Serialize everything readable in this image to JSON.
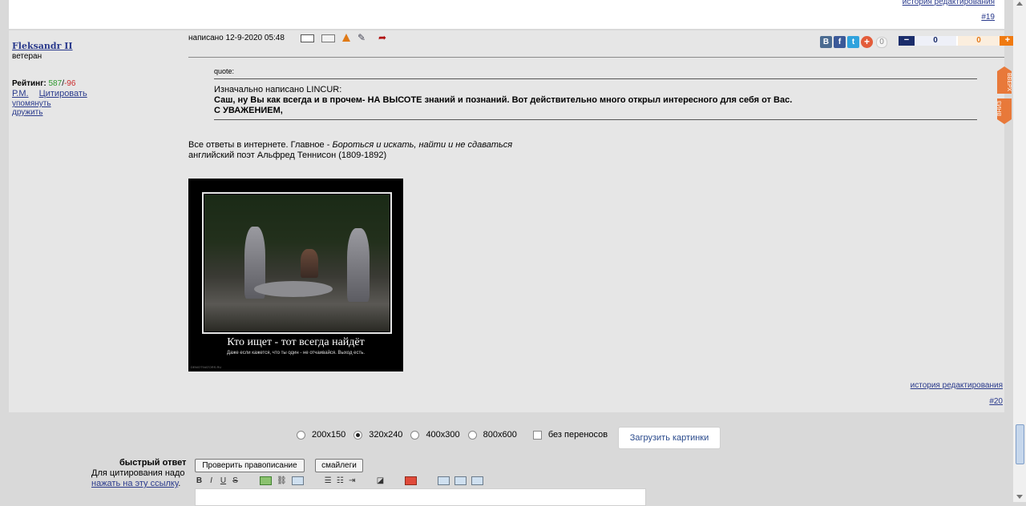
{
  "prev_post": {
    "history_link": "история редактирования",
    "post_number": "#19"
  },
  "post": {
    "author": "Fleksandr II",
    "rank": "ветеран",
    "rating_label": "Рейтинг:",
    "rating_pos": "587",
    "rating_sep": "/",
    "rating_neg": "-96",
    "link_pm": "Р.М.",
    "link_quote": "Цитировать",
    "link_mention": "упомянуть",
    "link_friend": "дружить",
    "posted": "написано 12-9-2020 05:48",
    "share": {
      "vk": "B",
      "fb": "f",
      "tw": "t",
      "plus": "+",
      "count": "0"
    },
    "vote": {
      "minus": "−",
      "neg": "0",
      "pos": "0",
      "plus": "+"
    },
    "quote_label": "quote:",
    "quote_orig": "Изначально написано LINCUR:",
    "quote_text": "Саш, ну Вы как всегда и в прочем- НА ВЫСОТЕ знаний и познаний. Вот действительно много открыл интересного для себя от Вас.",
    "quote_sign": "С УВАЖЕНИЕМ,",
    "body_prefix": "Все ответы в интернете. Главное - ",
    "body_italic": "Бороться и искать, найти и не сдаваться",
    "body_line2": "английский поэт Альфред Теннисон (1809-1892)",
    "demot_title": "Кто ищет - тот всегда найдёт",
    "demot_sub": "Даже если кажется, что ты один - не отчаивайся. Выход есть.",
    "demot_site": "DEMOTIVATORS.RU",
    "history_link": "история редактирования",
    "post_number": "#20"
  },
  "nav": {
    "up": "ВВЕРХ",
    "down": "ВНИЗ"
  },
  "image_sizes": {
    "options": [
      "200x150",
      "320x240",
      "400x300",
      "800x600"
    ],
    "selected": "320x240",
    "no_wrap": "без переносов",
    "upload": "Загрузить картинки"
  },
  "quick_reply": {
    "title": "быстрый ответ",
    "hint": "Для цитирования надо",
    "link": "нажать на эту ссылку",
    "link_suffix": ".",
    "spell_button": "Проверить правописание",
    "smiles_button": "смайлеги",
    "toolbar": {
      "bold": "B",
      "italic": "I",
      "underline": "U",
      "strike": "S"
    }
  },
  "colors": {
    "accent_orange": "#e8793a",
    "link": "#2a3a8c",
    "rating_pos": "#2e9a2e",
    "rating_neg": "#cc2b2b"
  }
}
